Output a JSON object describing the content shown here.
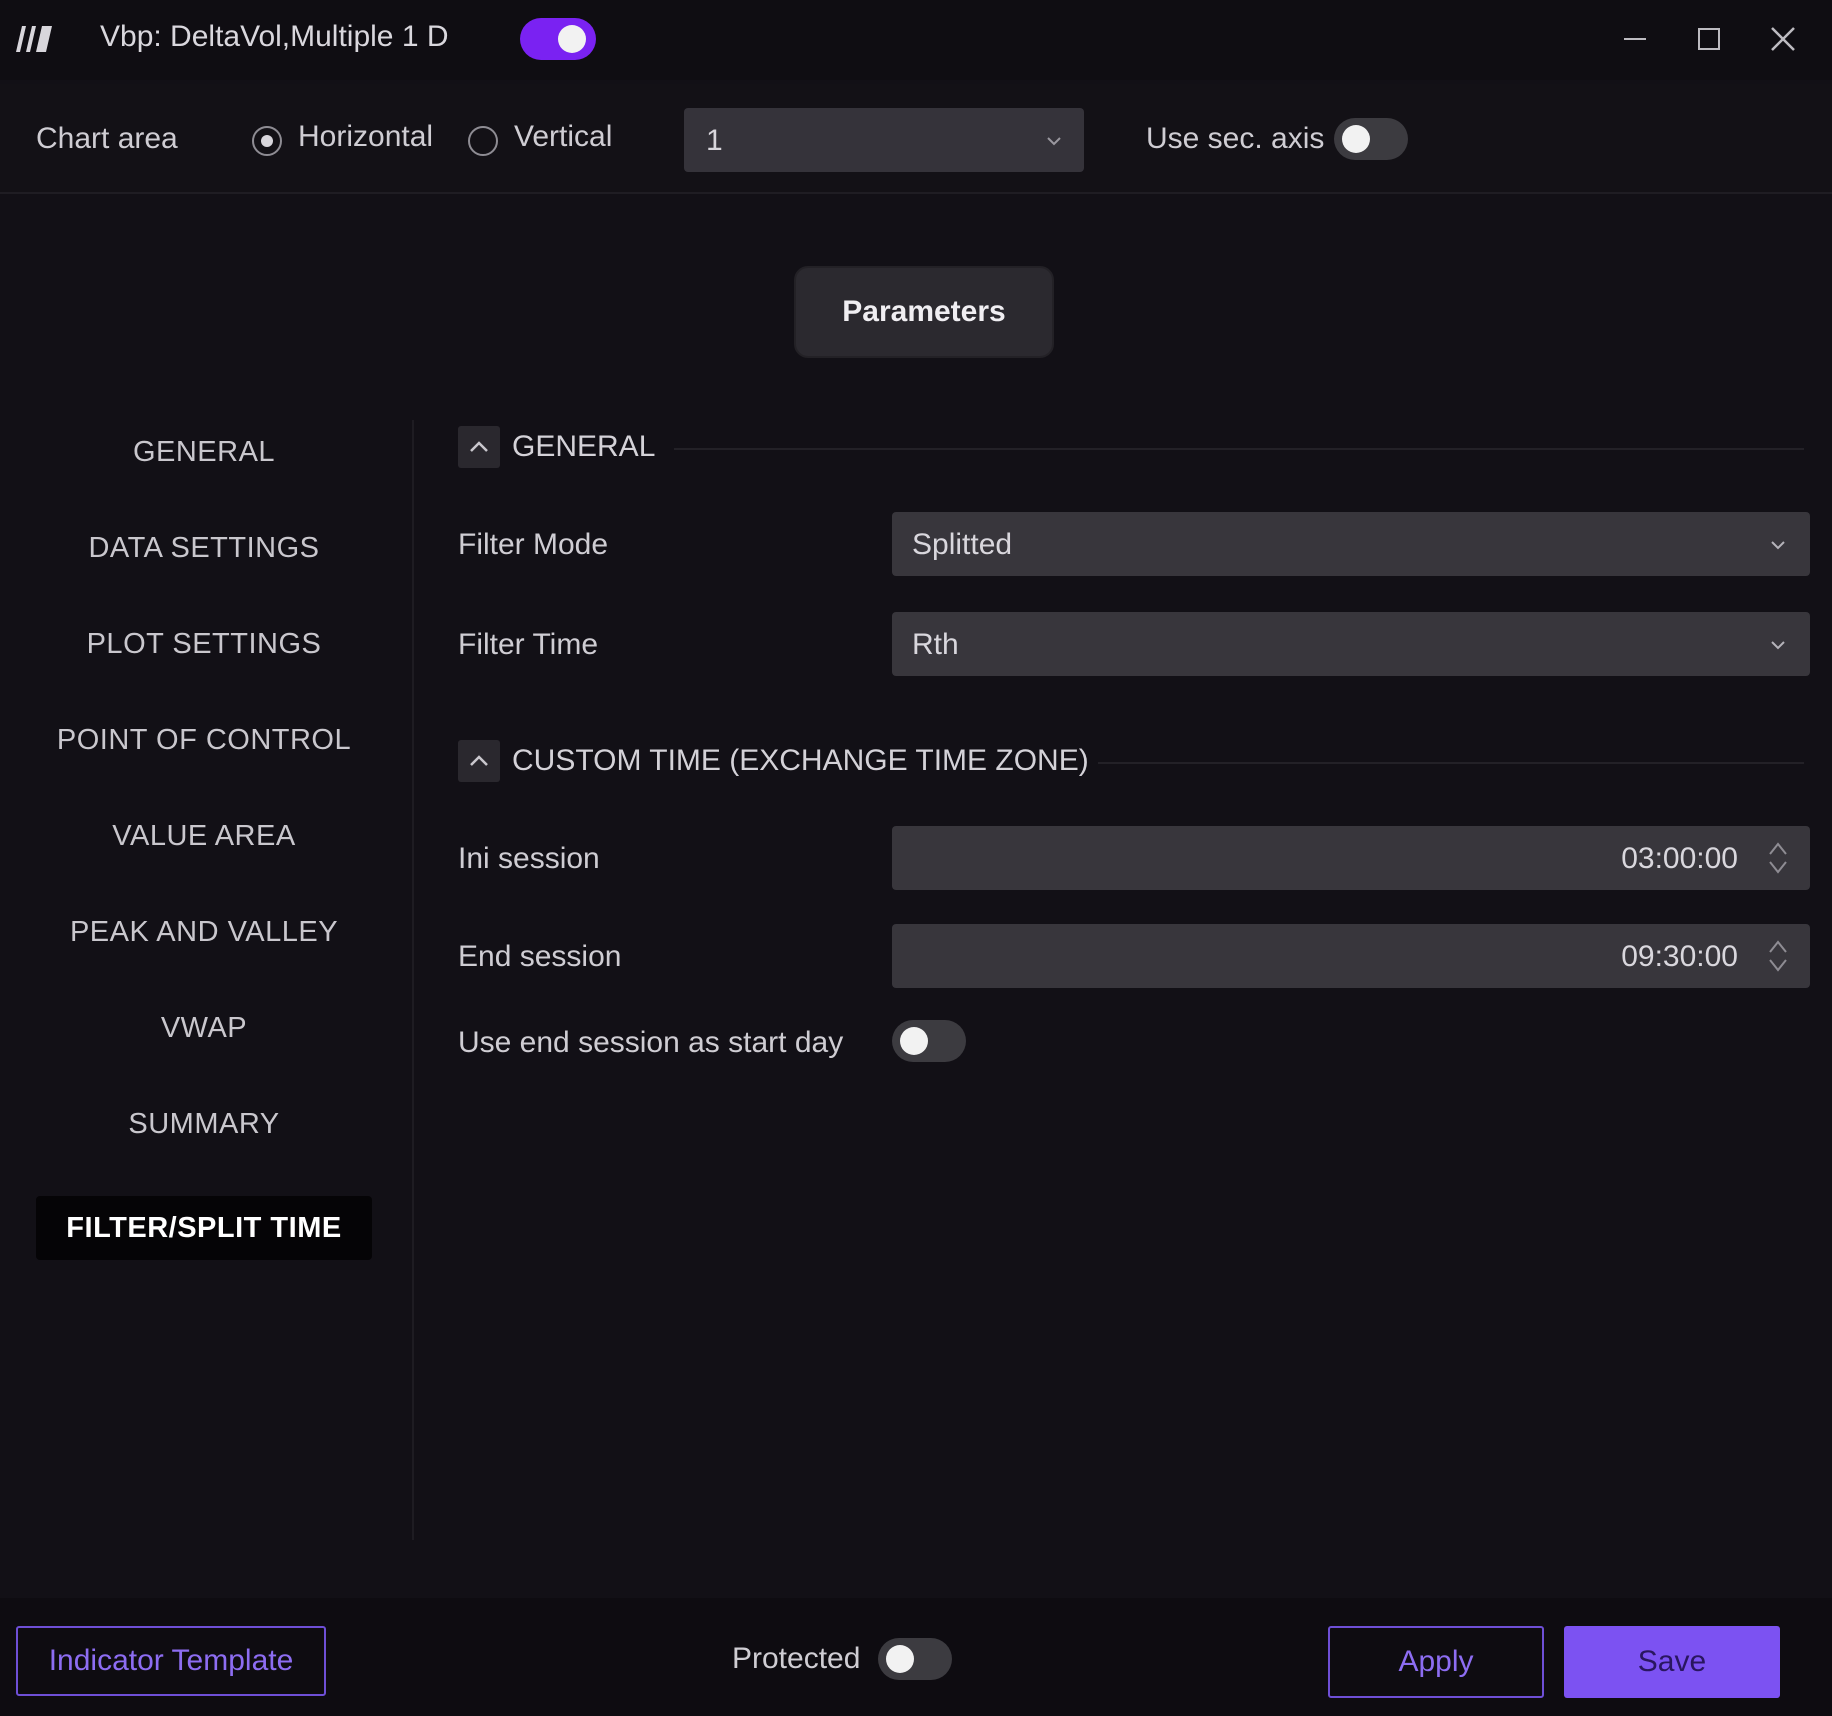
{
  "window": {
    "title": "Vbp: DeltaVol,Multiple 1 D",
    "enabled": true
  },
  "chart_area": {
    "label": "Chart area",
    "orientation_options": [
      "Horizontal",
      "Vertical"
    ],
    "selected_orientation": "Horizontal",
    "panel_value": "1",
    "sec_axis_label": "Use sec. axis",
    "sec_axis_on": false
  },
  "tabs": {
    "parameters": "Parameters"
  },
  "sidebar": {
    "items": [
      {
        "label": "GENERAL"
      },
      {
        "label": "DATA SETTINGS"
      },
      {
        "label": "PLOT SETTINGS"
      },
      {
        "label": "POINT OF CONTROL"
      },
      {
        "label": "VALUE AREA"
      },
      {
        "label": "PEAK AND VALLEY"
      },
      {
        "label": "VWAP"
      },
      {
        "label": "SUMMARY"
      },
      {
        "label": "FILTER/SPLIT TIME"
      }
    ],
    "active": "FILTER/SPLIT TIME"
  },
  "general_section": {
    "title": "GENERAL",
    "filter_mode_label": "Filter Mode",
    "filter_mode_value": "Splitted",
    "filter_time_label": "Filter Time",
    "filter_time_value": "Rth"
  },
  "custom_time_section": {
    "title": "CUSTOM TIME (EXCHANGE TIME ZONE)",
    "ini_session_label": "Ini session",
    "ini_session_value": "03:00:00",
    "end_session_label": "End session",
    "end_session_value": "09:30:00",
    "use_end_as_start_label": "Use end session as start day",
    "use_end_as_start_on": false
  },
  "footer": {
    "template_label": "Indicator Template",
    "protected_label": "Protected",
    "protected_on": false,
    "apply_label": "Apply",
    "save_label": "Save"
  },
  "colors": {
    "accent": "#7a22f2",
    "button_purple": "#7c52f2",
    "background": "#121016"
  }
}
